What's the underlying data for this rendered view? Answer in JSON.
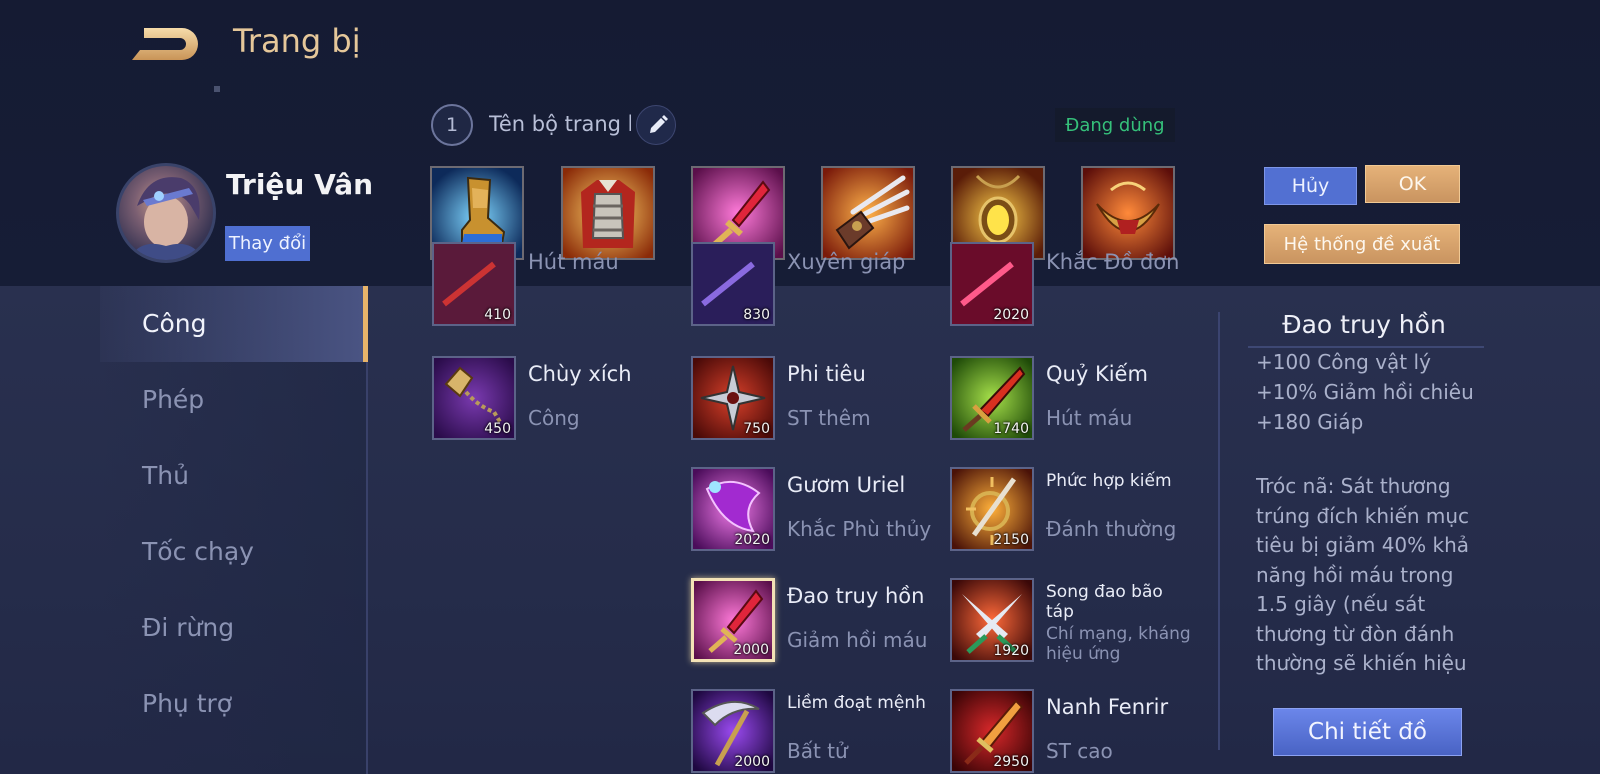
{
  "header": {
    "title": "Trang bị"
  },
  "hero": {
    "name": "Triệu Vân",
    "change_label": "Thay đổi"
  },
  "build": {
    "number": "1",
    "name": "Tên bộ trang bị",
    "status": "Đang dùng",
    "slots": [
      "boots-item",
      "armor-item",
      "dagger-item",
      "claw-item",
      "amulet-item",
      "crescent-item"
    ]
  },
  "actions": {
    "cancel": "Hủy",
    "ok": "OK",
    "suggest": "Hệ thống đề xuất"
  },
  "categories": [
    "Công",
    "Phép",
    "Thủ",
    "Tốc chạy",
    "Đi rừng",
    "Phụ trợ"
  ],
  "active_category": "Công",
  "items": {
    "col1": [
      {
        "name": "Hút máu",
        "price": "410"
      },
      {
        "name": "Chùy xích",
        "sub": "Công",
        "price": "450"
      }
    ],
    "col2": [
      {
        "name": "Xuyên giáp",
        "price": "830"
      },
      {
        "name": "Phi tiêu",
        "sub": "ST thêm",
        "price": "750"
      },
      {
        "name": "Gươm Uriel",
        "sub": "Khắc Phù thủy",
        "price": "2020"
      },
      {
        "name": "Đao truy hồn",
        "sub": "Giảm hồi máu",
        "price": "2000"
      },
      {
        "name": "Liềm đoạt mệnh",
        "sub": "Bất tử",
        "price": "2000"
      }
    ],
    "col3": [
      {
        "name": "Khắc Đồ đơn",
        "price": "2020"
      },
      {
        "name": "Quỷ Kiếm",
        "sub": "Hút máu",
        "price": "1740"
      },
      {
        "name": "Phức hợp kiếm",
        "sub": "Đánh thường",
        "price": "2150"
      },
      {
        "name": "Song đao bão táp",
        "sub": "Chí mạng, kháng hiệu ứng",
        "price": "1920"
      },
      {
        "name": "Nanh Fenrir",
        "sub": "ST cao",
        "price": "2950"
      }
    ]
  },
  "detail": {
    "title": "Đao truy hồn",
    "stats": [
      "+100 Công vật lý",
      "+10% Giảm hồi chiêu",
      "+180 Giáp"
    ],
    "passive": "Tróc nã: Sát thương trúng đích khiến mục tiêu bị giảm 40% khả năng hồi máu trong 1.5 giây (nếu sát thương từ đòn đánh thường sẽ khiến hiệu",
    "button": "Chi tiết đồ"
  },
  "colors": {
    "accent_gold": "#e5c79a",
    "button_blue": "#5270d2",
    "button_gold": "#d9a46c",
    "status_green": "#35c07a"
  }
}
